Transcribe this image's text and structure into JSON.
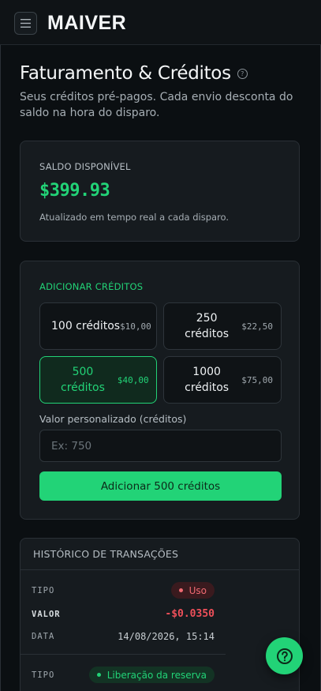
{
  "app": {
    "logo_text": "MAIVER"
  },
  "page": {
    "title": "Faturamento & Créditos",
    "subtitle": "Seus créditos pré-pagos. Cada envio desconta do saldo na hora do disparo."
  },
  "balance": {
    "label": "SALDO DISPONÍVEL",
    "value": "$399.93",
    "note": "Atualizado em tempo real a cada disparo."
  },
  "add_credits": {
    "title": "ADICIONAR CRÉDITOS",
    "packages": [
      {
        "name": "100 créditos",
        "price": "$10,00",
        "selected": false
      },
      {
        "name": "250 créditos",
        "price": "$22,50",
        "selected": false
      },
      {
        "name": "500 créditos",
        "price": "$40,00",
        "selected": true
      },
      {
        "name": "1000 créditos",
        "price": "$75,00",
        "selected": false
      }
    ],
    "custom_label": "Valor personalizado (créditos)",
    "custom_placeholder": "Ex: 750",
    "custom_value": "",
    "submit_label": "Adicionar 500 créditos"
  },
  "history": {
    "title": "HISTÓRICO DE TRANSAÇÕES",
    "keys": {
      "type": "TIPO",
      "value": "VALOR",
      "date": "DATA"
    },
    "transactions": [
      {
        "type": "Uso",
        "value": "-$0.0350",
        "date": "14/08/2026, 15:14",
        "status": "danger"
      },
      {
        "type": "Liberação da reserva",
        "status": "success"
      }
    ]
  },
  "colors": {
    "accent": "#22d377",
    "danger": "#f0505a",
    "background": "#0b0f12",
    "card": "#161b1f"
  },
  "icons": {
    "menu": "hamburger-icon",
    "title_help": "help-circle-icon",
    "fab": "help-circle-icon"
  }
}
